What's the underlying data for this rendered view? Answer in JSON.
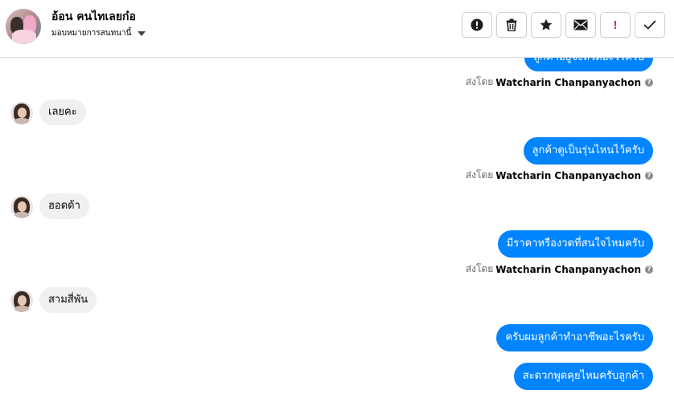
{
  "header": {
    "contact_name": "อ้อน คนไทเลยก๋อ",
    "assign_label": "มอบหมายการสนทนานี้",
    "avatar_alt": "contact-avatar",
    "toolbar": {
      "spam_icon": "alert-circle-icon",
      "delete_icon": "trash-icon",
      "star_icon": "star-icon",
      "mail_icon": "envelope-icon",
      "important_label": "!",
      "done_icon": "check-icon"
    }
  },
  "colors": {
    "outgoing_bubble": "#0084ff",
    "incoming_bubble": "#f0f0f0",
    "important": "#e41e3f"
  },
  "messages": [
    {
      "direction": "out",
      "text": "ลูกค้าอยู่จังหวัดอะไรครับ",
      "partial": true
    },
    {
      "direction": "meta",
      "prefix": "ส่งโดย",
      "sender": "Watcharin Chanpanyachon"
    },
    {
      "direction": "in",
      "text": "เลยคะ"
    },
    {
      "direction": "out",
      "text": "ลูกค้าดูเป็นรุ่นไหนไว้ครับ"
    },
    {
      "direction": "meta",
      "prefix": "ส่งโดย",
      "sender": "Watcharin Chanpanyachon"
    },
    {
      "direction": "in",
      "text": "ฮอดด้า"
    },
    {
      "direction": "out",
      "text": "มีราคาหรืองวดที่สนใจไหมครับ"
    },
    {
      "direction": "meta",
      "prefix": "ส่งโดย",
      "sender": "Watcharin Chanpanyachon"
    },
    {
      "direction": "in",
      "text": "สามสี่พัน"
    },
    {
      "direction": "out",
      "text": "ครับผมลูกค้าทำอาชีพอะไรครับ"
    },
    {
      "direction": "out",
      "text": "สะดวกพูดคุยไหมครับลูกค้า"
    }
  ]
}
